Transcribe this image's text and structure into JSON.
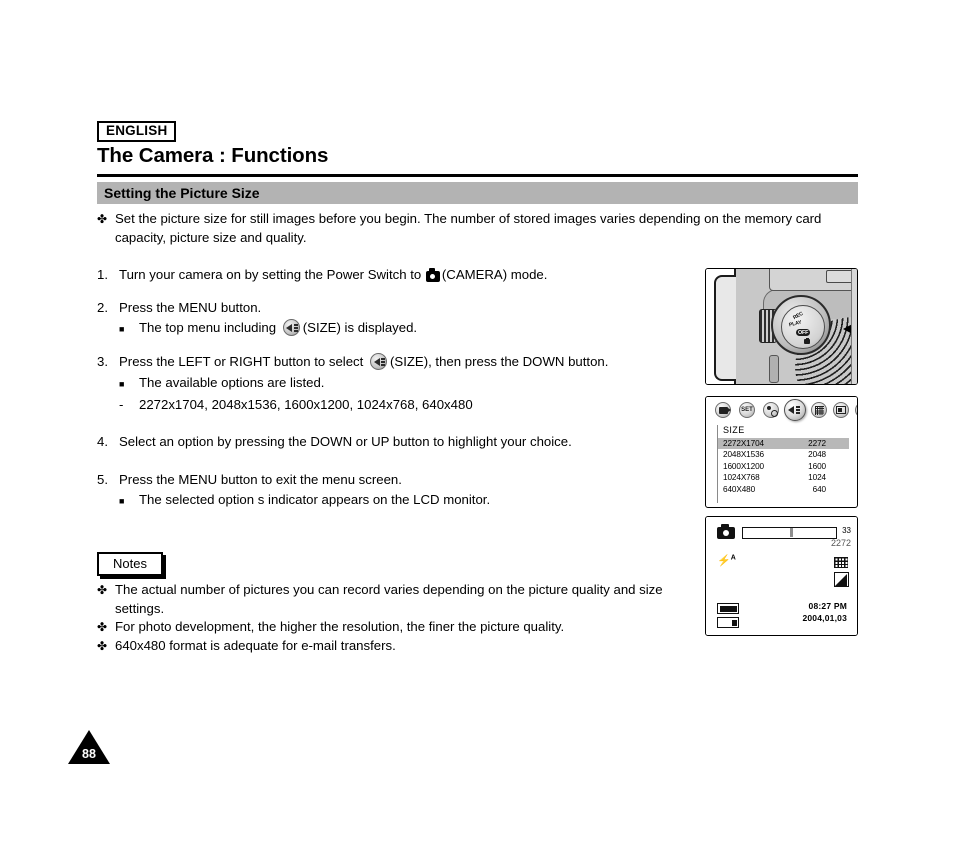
{
  "header": {
    "language_badge": "ENGLISH",
    "title": "The Camera : Functions",
    "section_title": "Setting the Picture Size"
  },
  "intro": {
    "bullet_mark": "✤",
    "text": "Set the picture size for still images before you begin. The number of stored images varies depending on the memory card capacity, picture size and quality."
  },
  "steps": [
    {
      "num": "1.",
      "text_before": "Turn your camera on by setting the Power Switch to",
      "icon": "camera-icon",
      "text_after": "(CAMERA) mode."
    },
    {
      "num": "2.",
      "text_before": "Press the MENU button.",
      "sub_mark": "■",
      "sub_before": "The top menu including",
      "icon": "size-icon",
      "sub_after": "(SIZE) is displayed."
    },
    {
      "num": "3.",
      "text_before": "Press the LEFT or RIGHT button to select",
      "icon": "size-icon",
      "text_after": "(SIZE), then press the DOWN button.",
      "sub_mark": "■",
      "sub_text": "The available options are listed.",
      "dash_mark": "-",
      "dash_text": "2272x1704, 2048x1536, 1600x1200, 1024x768, 640x480"
    },
    {
      "num": "4.",
      "text": "Select an option by pressing the DOWN or UP button to highlight your choice."
    },
    {
      "num": "5.",
      "text": "Press the MENU button to exit the menu screen.",
      "sub_mark": "■",
      "sub_text": "The selected option s indicator appears on the LCD monitor."
    }
  ],
  "notes": {
    "label": "Notes",
    "bullet_mark": "✤",
    "items": [
      "The actual number of pictures you can record varies depending on the picture quality and size settings.",
      "For photo development, the higher the resolution, the finer the picture quality.",
      "640x480 format is adequate for e-mail transfers."
    ]
  },
  "page_number": "88",
  "figures": {
    "camera": {
      "dial_labels": {
        "rec": "REC",
        "play": "PLAY",
        "off": "OFF",
        "camera_icon": "camera-icon"
      }
    },
    "menu": {
      "icons": [
        {
          "name": "record-icon",
          "label": ""
        },
        {
          "name": "set-icon",
          "label": "SET"
        },
        {
          "name": "self-timer-icon",
          "label": ""
        },
        {
          "name": "size-icon",
          "label": "",
          "selected": true
        },
        {
          "name": "quality-grid-icon",
          "label": ""
        },
        {
          "name": "lcd-icon",
          "label": ""
        },
        {
          "name": "effect-palette-icon",
          "label": ""
        }
      ],
      "panel_title": "SIZE",
      "options": [
        {
          "label": "2272X1704",
          "value": "2272",
          "selected": true
        },
        {
          "label": "2048X1536",
          "value": "2048",
          "selected": false
        },
        {
          "label": "1600X1200",
          "value": "1600",
          "selected": false
        },
        {
          "label": "1024X768",
          "value": "1024",
          "selected": false
        },
        {
          "label": "640X480",
          "value": "640",
          "selected": false
        }
      ]
    },
    "lcd": {
      "counter": "33",
      "size": "2272",
      "flash_mode": "A",
      "time": "08:27 PM",
      "date": "2004,01,03"
    }
  },
  "colors": {
    "section_bar": "#b3b3b3",
    "highlight_row": "#b8b8b8",
    "text": "#000000"
  }
}
